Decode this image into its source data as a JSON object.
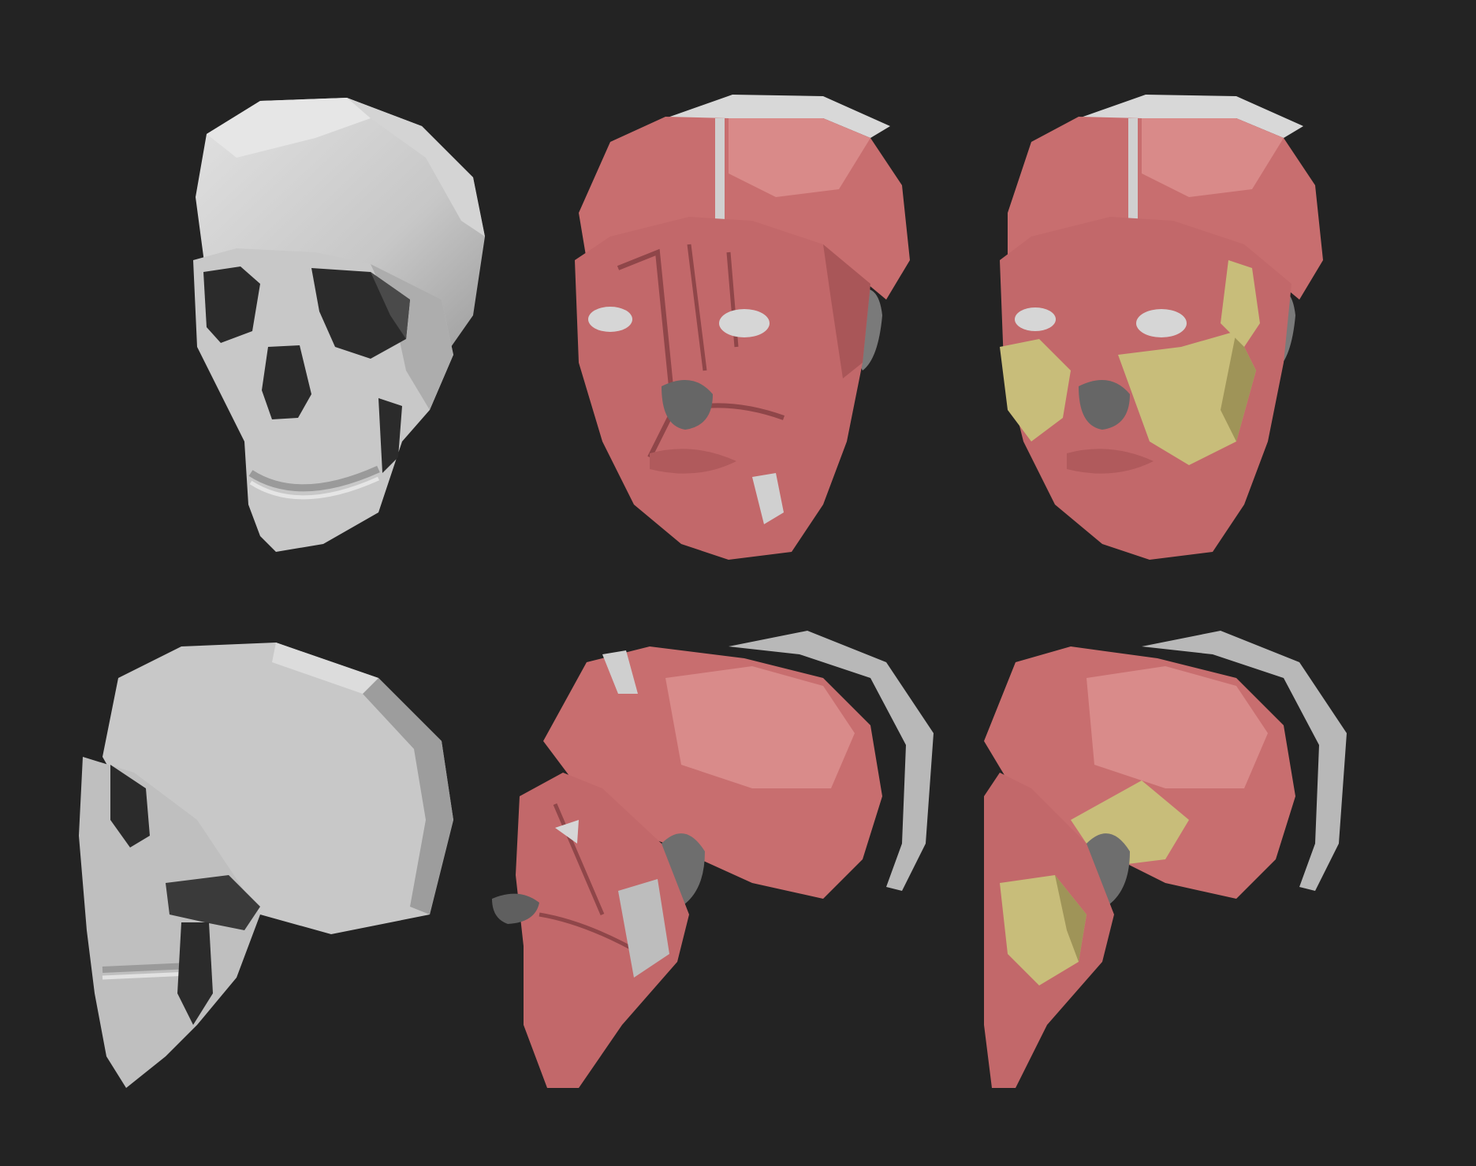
{
  "scene": {
    "background": "#232323",
    "colors": {
      "bone": "#c9c9c9",
      "bone_light": "#dedede",
      "bone_shadow": "#8e8e8e",
      "cavity": "#2b2b2b",
      "muscle": "#c2686a",
      "muscle_light": "#d98b8a",
      "muscle_shadow": "#8f4649",
      "fat_pad": "#c8bd7a",
      "fat_pad_shadow": "#9f9458",
      "cartilage": "#777777",
      "eye": "#d6d6d6"
    },
    "rows": [
      {
        "view": "front-three-quarter",
        "models": [
          {
            "name": "skull",
            "layers": [
              "bone"
            ]
          },
          {
            "name": "skull-with-muscles",
            "layers": [
              "bone",
              "muscle",
              "cartilage",
              "eye"
            ]
          },
          {
            "name": "skull-with-muscles-and-fat-pads",
            "layers": [
              "bone",
              "muscle",
              "cartilage",
              "eye",
              "fat_pad"
            ]
          }
        ]
      },
      {
        "view": "side",
        "models": [
          {
            "name": "skull",
            "layers": [
              "bone"
            ]
          },
          {
            "name": "skull-with-muscles",
            "layers": [
              "bone",
              "muscle",
              "cartilage",
              "eye"
            ]
          },
          {
            "name": "skull-with-muscles-and-fat-pads",
            "layers": [
              "bone",
              "muscle",
              "cartilage",
              "eye",
              "fat_pad"
            ]
          }
        ]
      }
    ]
  }
}
